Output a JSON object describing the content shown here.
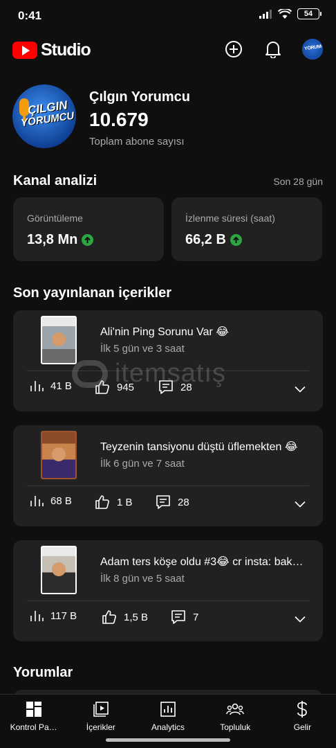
{
  "status_bar": {
    "time": "0:41",
    "battery": "54"
  },
  "header": {
    "logo_text": "Studio",
    "icons": [
      "add-icon",
      "bell-icon",
      "avatar"
    ]
  },
  "channel": {
    "name": "Çılgın Yorumcu",
    "subscriber_count": "10.679",
    "subscriber_label": "Toplam abone sayısı",
    "logo_text_1": "ÇILGIN",
    "logo_text_2": "YORUMCU"
  },
  "analytics": {
    "title": "Kanal analizi",
    "period": "Son 28 gün",
    "metrics": [
      {
        "label": "Görüntüleme",
        "value": "13,8 Mn",
        "trend": "up"
      },
      {
        "label": "İzlenme süresi (saat)",
        "value": "66,2 B",
        "trend": "up"
      }
    ]
  },
  "recent": {
    "title": "Son yayınlanan içerikler",
    "videos": [
      {
        "title": "Ali'nin Ping Sorunu Var 😂",
        "time": "İlk 5 gün ve 3 saat",
        "views": "41 B",
        "likes": "945",
        "comments": "28"
      },
      {
        "title": "Teyzenin tansiyonu düştü üflemekten 😂",
        "time": "İlk 6 gün ve 7 saat",
        "views": "68 B",
        "likes": "1 B",
        "comments": "28"
      },
      {
        "title": "Adam ters köşe oldu #3😂 cr insta: bak…",
        "time": "İlk 8 gün ve 5 saat",
        "views": "117 B",
        "likes": "1,5 B",
        "comments": "7"
      }
    ]
  },
  "comments_section": {
    "title": "Yorumlar"
  },
  "nav": [
    {
      "label": "Kontrol Pa…",
      "icon": "dashboard-icon"
    },
    {
      "label": "İçerikler",
      "icon": "content-icon"
    },
    {
      "label": "Analytics",
      "icon": "analytics-icon"
    },
    {
      "label": "Topluluk",
      "icon": "community-icon"
    },
    {
      "label": "Gelir",
      "icon": "earn-icon"
    }
  ],
  "watermark": "itemsatış",
  "colors": {
    "background": "#0f0f0f",
    "card": "#212121",
    "accent_red": "#ff0000",
    "trend_green": "#2ba640",
    "secondary_text": "#aaaaaa"
  }
}
